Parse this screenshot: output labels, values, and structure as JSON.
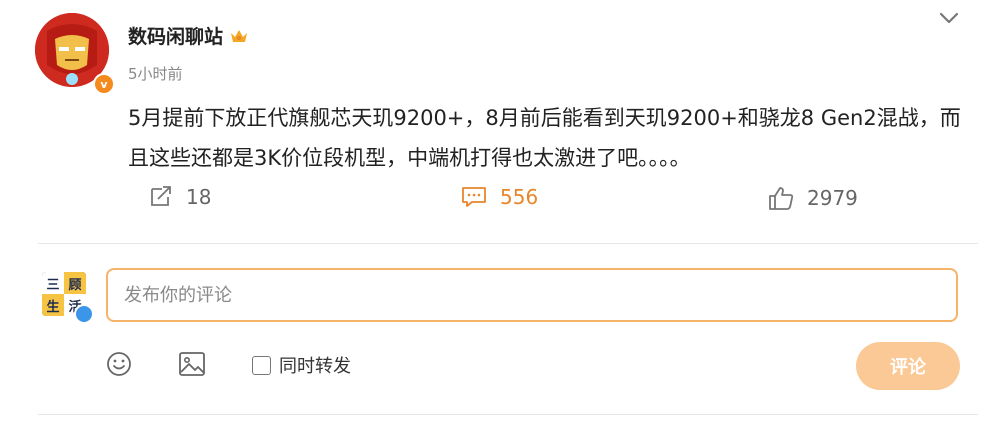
{
  "post": {
    "author": "数码闲聊站",
    "time": "5小时前",
    "content": "5月提前下放正代旗舰芯天玑9200+，8月前后能看到天玑9200+和骁龙8 Gen2混战，而且这些还都是3K价位段机型，中端机打得也太激进了吧。。。。",
    "verified_badge_letter": "v"
  },
  "actions": {
    "repost_count": "18",
    "comment_count": "556",
    "like_count": "2979"
  },
  "composer": {
    "avatar_text": [
      "三",
      "顾",
      "生",
      "活"
    ],
    "placeholder": "发布你的评论",
    "also_repost_label": "同时转发",
    "submit_label": "评论"
  },
  "colors": {
    "accent": "#e8862c",
    "input_border": "#f5b46a",
    "submit_bg": "#fbc996"
  },
  "icons": [
    "chevron-down-icon",
    "crown-icon",
    "repost-icon",
    "comment-icon",
    "like-icon",
    "emoji-icon",
    "image-icon"
  ]
}
